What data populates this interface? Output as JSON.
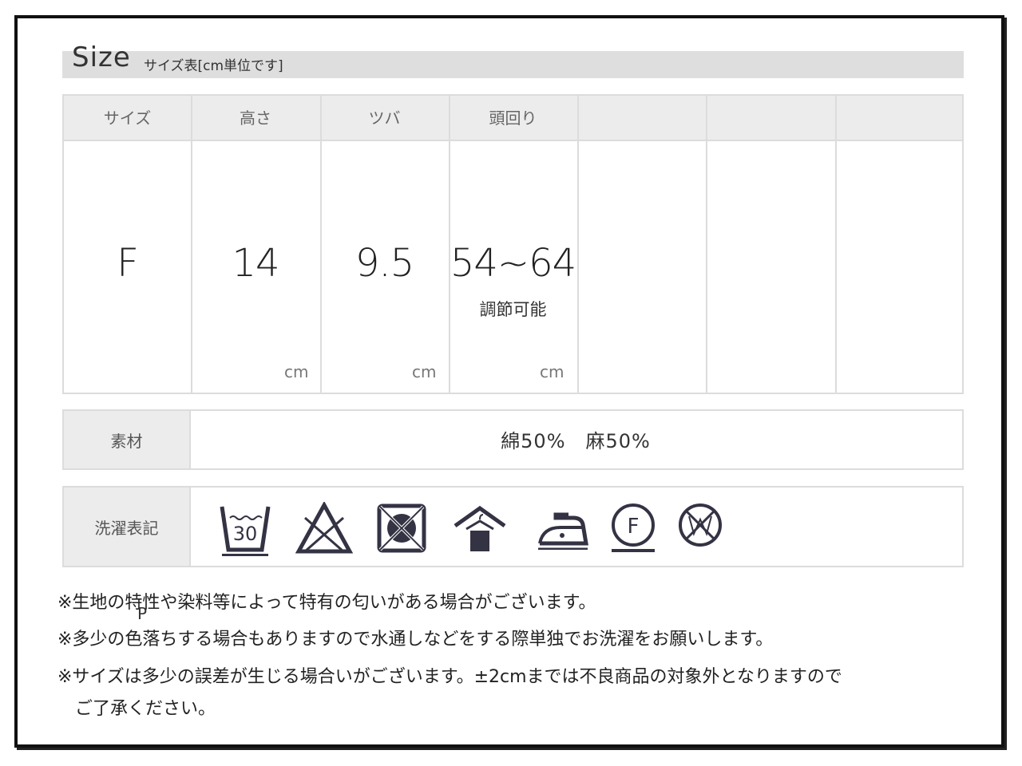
{
  "header": {
    "title": "Size",
    "subtitle": "サイズ表[cm単位です]"
  },
  "size_table": {
    "headers": [
      "サイズ",
      "高さ",
      "ツバ",
      "頭回り",
      "",
      "",
      ""
    ],
    "values": [
      "F",
      "14",
      "9.5",
      "54~64"
    ],
    "head_note": "調節可能",
    "unit": "cm"
  },
  "material": {
    "label": "素材",
    "value": "綿50%　麻50%"
  },
  "care": {
    "label": "洗濯表記",
    "wash_temp": "30",
    "dryclean_letter": "F",
    "icons": [
      "wash-30-icon",
      "no-bleach-icon",
      "no-tumble-dry-icon",
      "hang-dry-icon",
      "iron-low-icon",
      "dryclean-f-icon",
      "no-wet-clean-icon"
    ]
  },
  "notes": [
    "※生地の特性や染料等によって特有の匂いがある場合がございます。",
    "※多少の色落ちする場合もありますので水通しなどをする際単独でお洗濯をお願いします。",
    "※サイズは多少の誤差が生じる場合いがございます。±2cmまでは不良商品の対象外となりますので",
    "　ご了承ください。"
  ],
  "stray_mark": "P"
}
